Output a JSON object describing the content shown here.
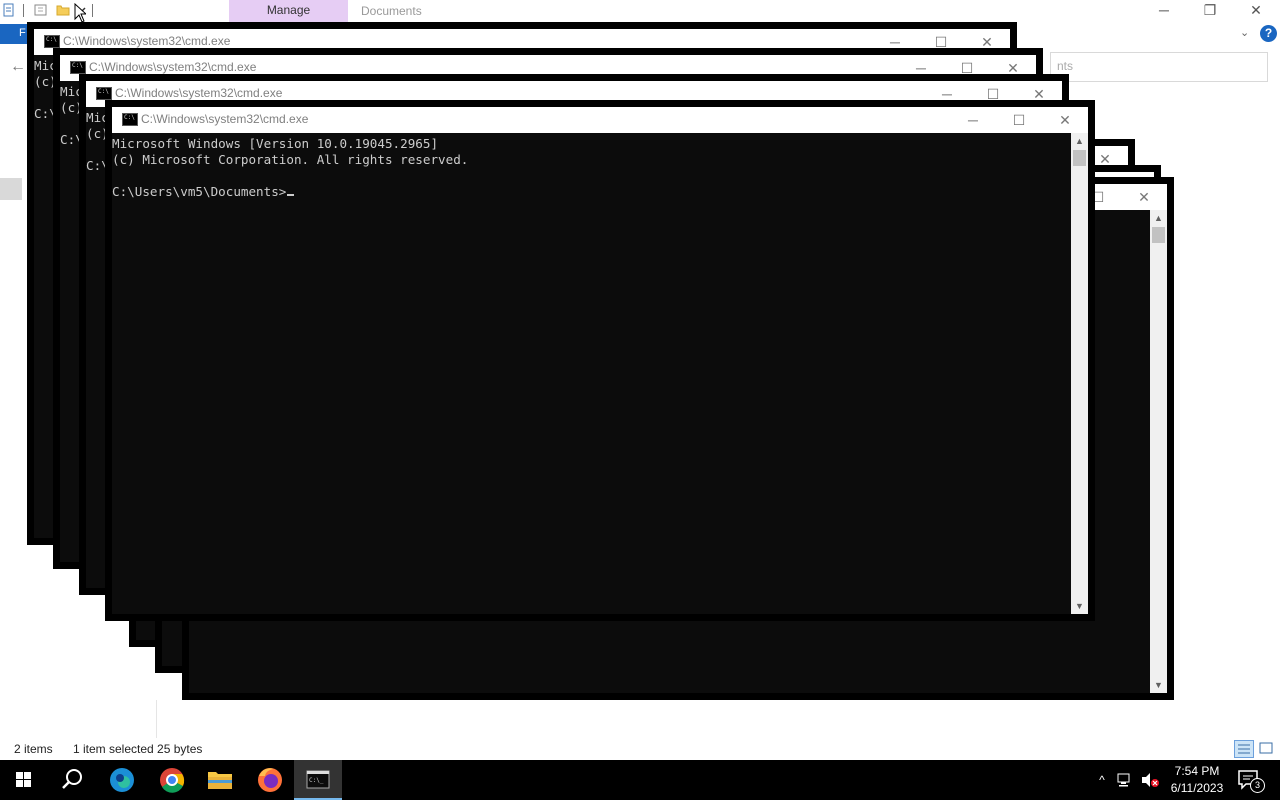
{
  "explorer": {
    "manage_tab": "Manage",
    "title": "Documents",
    "file_tab": "F",
    "address_text": "nts",
    "status_items": "2 items",
    "status_selected": "1 item selected  25 bytes",
    "help_glyph": "?",
    "controls": {
      "minimize": "─",
      "restore": "❐",
      "close": "✕"
    }
  },
  "cmd_windows": [
    {
      "title": "C:\\Windows\\system32\\cmd.exe",
      "partial_text": "Mic\n(c)\n\nC:\\"
    },
    {
      "title": "C:\\Windows\\system32\\cmd.exe",
      "partial_text": "Mic\n(c)\n\nC:\\"
    },
    {
      "title": "C:\\Windows\\system32\\cmd.exe",
      "partial_text": "Mic\n(c)\n\nC:\\"
    },
    {
      "title": "C:\\Windows\\system32\\cmd.exe",
      "line1": "Microsoft Windows [Version 10.0.19045.2965]",
      "line2": "(c) Microsoft Corporation. All rights reserved.",
      "prompt": "C:\\Users\\vm5\\Documents>"
    }
  ],
  "cmd_controls": {
    "minimize": "─",
    "maximize": "☐",
    "close": "✕",
    "scroll_up": "▲",
    "scroll_down": "▼"
  },
  "taskbar": {
    "items": [
      "start-icon",
      "search-icon",
      "edge-icon",
      "chrome-icon",
      "file-explorer-icon",
      "firefox-icon",
      "cmd-icon"
    ],
    "tray_chevron": "^",
    "time": "7:54 PM",
    "date": "6/11/2023",
    "notification_count": "3"
  }
}
